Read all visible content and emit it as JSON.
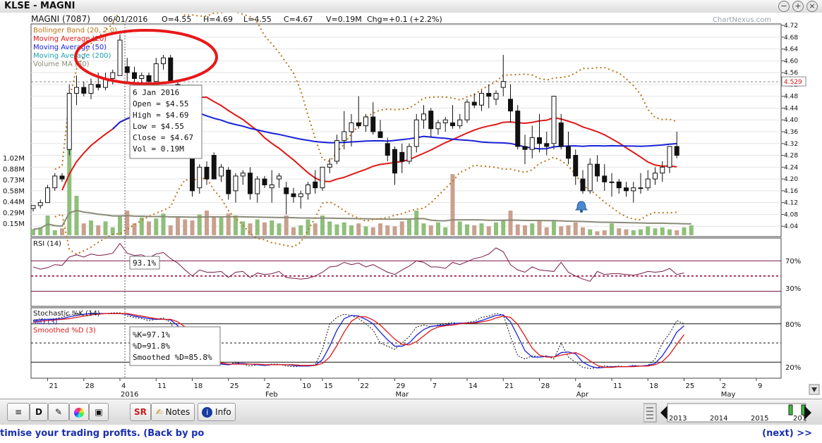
{
  "window": {
    "title": "KLSE - MAGNI",
    "btn_min": "−",
    "btn_max": "+",
    "btn_close": "×"
  },
  "header": {
    "name": "MAGNI (7087)",
    "date": "06/01/2016",
    "open": "O=4.55",
    "high": "H=4.69",
    "low": "L=4.55",
    "close": "C=4.67",
    "volume": "V=0.19M",
    "change": "Chg=+0.1 (+2.2%)",
    "watermark": "ChartNexus.com"
  },
  "legend": [
    {
      "label": "Bollinger Band (20, 2.0)",
      "color": "#b8761a"
    },
    {
      "label": "Moving Average (20)",
      "color": "#e01818"
    },
    {
      "label": "Moving Average (50)",
      "color": "#1a22d8"
    },
    {
      "label": "Moving Average (200)",
      "color": "#1a9fb0"
    },
    {
      "label": "Volume MA (50)",
      "color": "#8a8a78"
    }
  ],
  "tooltip": {
    "date": "6 Jan 2016",
    "open": "Open  = $4.55",
    "high": "High  = $4.69",
    "low": "Low   = $4.55",
    "close": "Close = $4.67",
    "vol": "Vol   = 0.19M"
  },
  "rsi_panel": {
    "label": "RSI (14)",
    "tooltip": "93.1%",
    "upper": 70,
    "lower": 30,
    "upper_label": "70%",
    "lower_label": "30%"
  },
  "stoch_panel": {
    "label_k": "Stochastic %K (14)",
    "label_d": "%D (3)",
    "label_sd": "Smoothed %D (3)",
    "tt_k": "%K=97.1%",
    "tt_d": "%D=91.8%",
    "tt_sd": "Smoothed %D=85.8%",
    "upper_label": "80%",
    "lower_label": "20%"
  },
  "toolbar": {
    "btn_d": "D",
    "btn_sr": "SR",
    "btn_notes": "Notes",
    "btn_info": "Info",
    "years": [
      "2013",
      "2014",
      "2015",
      "201"
    ]
  },
  "ticker": {
    "left": "timise your trading profits. (Back by po",
    "right": "(next) >>"
  },
  "chart_data": {
    "type": "candlestick",
    "price_axis": {
      "min": 4.0,
      "max": 4.72,
      "ticks": [
        "4.04",
        "4.08",
        "4.12",
        "4.16",
        "4.20",
        "4.24",
        "4.28",
        "4.32",
        "4.36",
        "4.40",
        "4.44",
        "4.48",
        "4.52",
        "4.56",
        "4.60",
        "4.64",
        "4.68",
        "4.72"
      ]
    },
    "last_price": "4.529",
    "volume_axis": {
      "ticks": [
        "0.15M",
        "0.29M",
        "0.44M",
        "0.58M",
        "0.73M",
        "0.88M",
        "1.02M"
      ]
    },
    "x_ticks": [
      {
        "label": "21",
        "i": 2
      },
      {
        "label": "28",
        "i": 7
      },
      {
        "label": "4",
        "i": 12
      },
      {
        "label": "11",
        "i": 17
      },
      {
        "label": "18",
        "i": 22
      },
      {
        "label": "25",
        "i": 27
      },
      {
        "label": "2",
        "i": 32
      },
      {
        "label": "10",
        "i": 37
      },
      {
        "label": "15",
        "i": 40
      },
      {
        "label": "22",
        "i": 45
      },
      {
        "label": "29",
        "i": 50
      },
      {
        "label": "7",
        "i": 55
      },
      {
        "label": "14",
        "i": 60
      },
      {
        "label": "21",
        "i": 65
      },
      {
        "label": "28",
        "i": 70
      },
      {
        "label": "4",
        "i": 75
      },
      {
        "label": "11",
        "i": 80
      },
      {
        "label": "18",
        "i": 85
      },
      {
        "label": "25",
        "i": 90
      },
      {
        "label": "2",
        "i": 95
      },
      {
        "label": "9",
        "i": 100
      }
    ],
    "x_sub": [
      {
        "label": "2016",
        "i": 12
      },
      {
        "label": "Feb",
        "i": 32
      },
      {
        "label": "Mar",
        "i": 50
      },
      {
        "label": "Apr",
        "i": 75
      },
      {
        "label": "May",
        "i": 95
      }
    ],
    "candles": [
      [
        4.1,
        4.11,
        4.09,
        4.11
      ],
      [
        4.11,
        4.13,
        4.1,
        4.12
      ],
      [
        4.12,
        4.18,
        4.12,
        4.17
      ],
      [
        4.17,
        4.22,
        4.16,
        4.21
      ],
      [
        4.21,
        4.22,
        4.19,
        4.2
      ],
      [
        4.3,
        4.52,
        4.28,
        4.49
      ],
      [
        4.49,
        4.55,
        4.45,
        4.51
      ],
      [
        4.51,
        4.53,
        4.48,
        4.49
      ],
      [
        4.49,
        4.54,
        4.47,
        4.52
      ],
      [
        4.52,
        4.56,
        4.5,
        4.51
      ],
      [
        4.51,
        4.56,
        4.5,
        4.54
      ],
      [
        4.54,
        4.57,
        4.52,
        4.56
      ],
      [
        4.55,
        4.69,
        4.55,
        4.67
      ],
      [
        4.58,
        4.61,
        4.53,
        4.56
      ],
      [
        4.56,
        4.58,
        4.52,
        4.54
      ],
      [
        4.54,
        4.56,
        4.51,
        4.55
      ],
      [
        4.55,
        4.56,
        4.5,
        4.53
      ],
      [
        4.53,
        4.61,
        4.53,
        4.59
      ],
      [
        4.59,
        4.62,
        4.57,
        4.61
      ],
      [
        4.61,
        4.62,
        4.53,
        4.53
      ],
      [
        4.52,
        4.53,
        4.4,
        4.45
      ],
      [
        4.45,
        4.46,
        4.27,
        4.28
      ],
      [
        4.28,
        4.3,
        4.14,
        4.16
      ],
      [
        4.17,
        4.25,
        4.15,
        4.24
      ],
      [
        4.24,
        4.26,
        4.18,
        4.2
      ],
      [
        4.28,
        4.29,
        4.2,
        4.2
      ],
      [
        4.21,
        4.25,
        4.19,
        4.24
      ],
      [
        4.23,
        4.24,
        4.13,
        4.15
      ],
      [
        4.16,
        4.22,
        4.12,
        4.21
      ],
      [
        4.21,
        4.23,
        4.18,
        4.22
      ],
      [
        4.22,
        4.24,
        4.13,
        4.15
      ],
      [
        4.15,
        4.21,
        4.12,
        4.2
      ],
      [
        4.2,
        4.21,
        4.17,
        4.18
      ],
      [
        4.17,
        4.23,
        4.12,
        4.18
      ],
      [
        4.2,
        4.22,
        4.17,
        4.21
      ],
      [
        4.17,
        4.19,
        4.08,
        4.15
      ],
      [
        4.15,
        4.17,
        4.12,
        4.14
      ],
      [
        4.14,
        4.16,
        4.1,
        4.15
      ],
      [
        4.15,
        4.19,
        4.13,
        4.18
      ],
      [
        4.19,
        4.23,
        4.15,
        4.17
      ],
      [
        4.17,
        4.24,
        4.16,
        4.24
      ],
      [
        4.24,
        4.27,
        4.22,
        4.25
      ],
      [
        4.26,
        4.35,
        4.25,
        4.33
      ],
      [
        4.33,
        4.43,
        4.3,
        4.36
      ],
      [
        4.36,
        4.42,
        4.31,
        4.39
      ],
      [
        4.39,
        4.48,
        4.37,
        4.38
      ],
      [
        4.38,
        4.42,
        4.36,
        4.41
      ],
      [
        4.41,
        4.46,
        4.35,
        4.36
      ],
      [
        4.36,
        4.4,
        4.34,
        4.34
      ],
      [
        4.32,
        4.34,
        4.26,
        4.28
      ],
      [
        4.3,
        4.31,
        4.18,
        4.22
      ],
      [
        4.29,
        4.32,
        4.22,
        4.26
      ],
      [
        4.26,
        4.32,
        4.25,
        4.31
      ],
      [
        4.31,
        4.42,
        4.29,
        4.4
      ],
      [
        4.4,
        4.45,
        4.37,
        4.42
      ],
      [
        4.43,
        4.44,
        4.34,
        4.37
      ],
      [
        4.37,
        4.4,
        4.35,
        4.39
      ],
      [
        4.39,
        4.41,
        4.36,
        4.4
      ],
      [
        4.39,
        4.45,
        4.37,
        4.38
      ],
      [
        4.38,
        4.42,
        4.37,
        4.4
      ],
      [
        4.4,
        4.47,
        4.39,
        4.46
      ],
      [
        4.46,
        4.49,
        4.44,
        4.45
      ],
      [
        4.45,
        4.5,
        4.43,
        4.49
      ],
      [
        4.49,
        4.52,
        4.44,
        4.48
      ],
      [
        4.47,
        4.5,
        4.45,
        4.49
      ],
      [
        4.51,
        4.62,
        4.48,
        4.53
      ],
      [
        4.47,
        4.52,
        4.39,
        4.43
      ],
      [
        4.43,
        4.45,
        4.3,
        4.31
      ],
      [
        4.31,
        4.35,
        4.25,
        4.3
      ],
      [
        4.3,
        4.38,
        4.27,
        4.34
      ],
      [
        4.34,
        4.42,
        4.29,
        4.32
      ],
      [
        4.32,
        4.36,
        4.28,
        4.31
      ],
      [
        4.32,
        4.48,
        4.3,
        4.48
      ],
      [
        4.39,
        4.42,
        4.3,
        4.31
      ],
      [
        4.31,
        4.36,
        4.25,
        4.27
      ],
      [
        4.28,
        4.3,
        4.18,
        4.21
      ],
      [
        4.2,
        4.23,
        4.15,
        4.16
      ],
      [
        4.16,
        4.27,
        4.15,
        4.25
      ],
      [
        4.25,
        4.28,
        4.19,
        4.21
      ],
      [
        4.21,
        4.25,
        4.16,
        4.19
      ],
      [
        4.19,
        4.22,
        4.14,
        4.19
      ],
      [
        4.19,
        4.2,
        4.15,
        4.17
      ],
      [
        4.17,
        4.19,
        4.14,
        4.16
      ],
      [
        4.16,
        4.19,
        4.12,
        4.17
      ],
      [
        4.17,
        4.22,
        4.15,
        4.17
      ],
      [
        4.17,
        4.23,
        4.16,
        4.2
      ],
      [
        4.2,
        4.24,
        4.18,
        4.22
      ],
      [
        4.22,
        4.26,
        4.19,
        4.24
      ],
      [
        4.24,
        4.31,
        4.22,
        4.31
      ],
      [
        4.31,
        4.36,
        4.27,
        4.28
      ]
    ],
    "volume": [
      0.06,
      0.08,
      0.2,
      0.05,
      0.07,
      0.9,
      0.4,
      0.12,
      0.15,
      0.1,
      0.14,
      0.08,
      0.19,
      0.25,
      0.12,
      0.18,
      0.14,
      0.17,
      0.22,
      0.1,
      0.18,
      0.16,
      0.15,
      0.21,
      0.25,
      0.19,
      0.18,
      0.22,
      0.2,
      0.14,
      0.12,
      0.16,
      0.13,
      0.15,
      0.12,
      0.2,
      0.08,
      0.1,
      0.16,
      0.12,
      0.2,
      0.14,
      0.11,
      0.13,
      0.1,
      0.12,
      0.09,
      0.08,
      0.12,
      0.1,
      0.09,
      0.14,
      0.16,
      0.25,
      0.12,
      0.1,
      0.13,
      0.08,
      0.62,
      0.14,
      0.11,
      0.1,
      0.12,
      0.09,
      0.13,
      0.15,
      0.25,
      0.11,
      0.1,
      0.12,
      0.15,
      0.08,
      0.14,
      0.09,
      0.1,
      0.13,
      0.08,
      0.06,
      0.04,
      0.05,
      0.12,
      0.07,
      0.06,
      0.05,
      0.06,
      0.09,
      0.07,
      0.08,
      0.06,
      0.05,
      0.08,
      0.1
    ],
    "rsi": [
      62,
      59,
      61,
      65,
      64,
      75,
      78,
      75,
      79,
      77,
      78,
      80,
      93,
      80,
      77,
      78,
      74,
      79,
      81,
      73,
      67,
      58,
      50,
      58,
      55,
      55,
      56,
      48,
      55,
      56,
      48,
      54,
      52,
      53,
      56,
      48,
      47,
      46,
      47,
      50,
      55,
      62,
      63,
      68,
      65,
      67,
      62,
      65,
      60,
      55,
      52,
      58,
      63,
      70,
      68,
      62,
      62,
      60,
      68,
      65,
      69,
      73,
      75,
      79,
      87,
      82,
      65,
      58,
      55,
      62,
      58,
      57,
      56,
      68,
      55,
      50,
      46,
      43,
      56,
      52,
      53,
      53,
      52,
      51,
      53,
      56,
      55,
      56,
      60,
      52,
      54
    ],
    "stoch_k": [
      85,
      88,
      87,
      88,
      90,
      94,
      96,
      94,
      97,
      95,
      96,
      97,
      97,
      92,
      90,
      88,
      85,
      87,
      89,
      82,
      60,
      40,
      25,
      20,
      18,
      15,
      18,
      16,
      20,
      17,
      14,
      16,
      15,
      17,
      17,
      14,
      13,
      14,
      15,
      16,
      40,
      80,
      90,
      95,
      93,
      88,
      80,
      70,
      50,
      45,
      40,
      50,
      60,
      75,
      78,
      75,
      78,
      80,
      82,
      80,
      82,
      84,
      90,
      92,
      96,
      94,
      60,
      30,
      25,
      30,
      28,
      30,
      25,
      50,
      28,
      20,
      12,
      10,
      12,
      14,
      13,
      14,
      13,
      15,
      14,
      15,
      25,
      50,
      65,
      85,
      80
    ],
    "stoch_d": [
      84,
      86,
      87,
      87,
      88,
      91,
      93,
      95,
      96,
      96,
      96,
      96,
      96,
      95,
      92,
      90,
      88,
      87,
      87,
      86,
      77,
      61,
      42,
      28,
      21,
      18,
      17,
      16,
      18,
      18,
      17,
      16,
      15,
      16,
      16,
      16,
      15,
      14,
      14,
      15,
      24,
      45,
      70,
      88,
      93,
      92,
      87,
      80,
      67,
      55,
      45,
      45,
      50,
      62,
      71,
      76,
      77,
      78,
      80,
      81,
      81,
      82,
      85,
      89,
      93,
      94,
      83,
      61,
      38,
      28,
      28,
      29,
      28,
      35,
      36,
      33,
      20,
      14,
      11,
      12,
      13,
      13,
      13,
      14,
      14,
      15,
      18,
      30,
      47,
      67,
      77
    ],
    "stoch_sd": [
      82,
      84,
      85,
      86,
      87,
      88,
      90,
      92,
      94,
      95,
      96,
      96,
      96,
      96,
      94,
      92,
      90,
      88,
      87,
      87,
      83,
      75,
      60,
      44,
      30,
      22,
      19,
      17,
      17,
      17,
      17,
      17,
      16,
      16,
      16,
      16,
      16,
      15,
      15,
      15,
      18,
      28,
      46,
      67,
      84,
      91,
      91,
      86,
      78,
      67,
      56,
      48,
      47,
      52,
      61,
      70,
      75,
      77,
      78,
      80,
      81,
      81,
      83,
      85,
      89,
      92,
      90,
      79,
      61,
      42,
      31,
      28,
      28,
      31,
      33,
      35,
      30,
      22,
      15,
      12,
      12,
      13,
      13,
      13,
      14,
      14,
      16,
      21,
      32,
      48,
      63
    ]
  }
}
